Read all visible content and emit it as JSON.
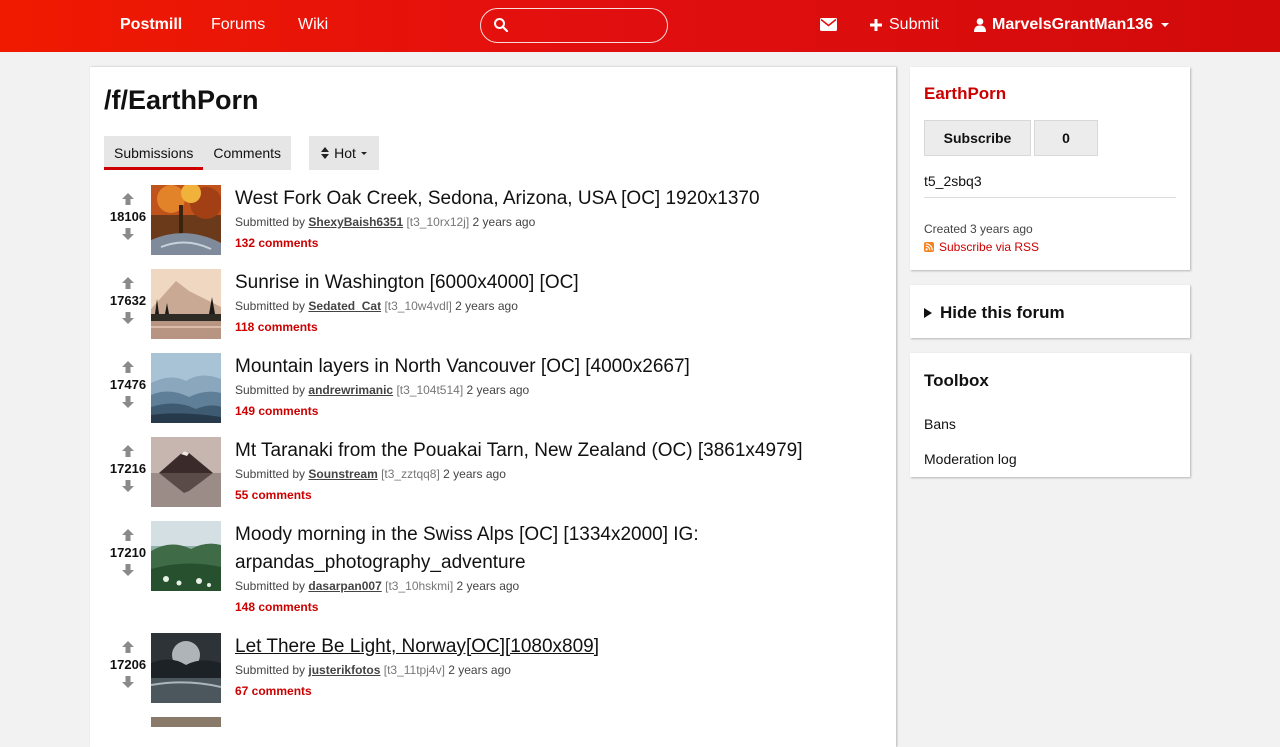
{
  "nav": {
    "brand": "Postmill",
    "forums": "Forums",
    "wiki": "Wiki",
    "search_placeholder": "",
    "submit": "Submit",
    "user": "MarvelsGrantMan136"
  },
  "forum": {
    "title": "/f/EarthPorn",
    "tabs": [
      "Submissions",
      "Comments"
    ],
    "sort": "Hot"
  },
  "submissions": [
    {
      "score": "18106",
      "title": "West Fork Oak Creek, Sedona, Arizona, USA [OC] 1920x1370",
      "submitted_by": "Submitted by",
      "author": "ShexyBaish6351",
      "id": "[t3_10rx12j]",
      "age": "2 years ago",
      "comments": "132 comments"
    },
    {
      "score": "17632",
      "title": "Sunrise in Washington [6000x4000] [OC]",
      "submitted_by": "Submitted by",
      "author": "Sedated_Cat",
      "id": "[t3_10w4vdl]",
      "age": "2 years ago",
      "comments": "118 comments"
    },
    {
      "score": "17476",
      "title": "Mountain layers in North Vancouver [OC] [4000x2667]",
      "submitted_by": "Submitted by",
      "author": "andrewrimanic",
      "id": "[t3_104t514]",
      "age": "2 years ago",
      "comments": "149 comments"
    },
    {
      "score": "17216",
      "title": "Mt Taranaki from the Pouakai Tarn, New Zealand (OC) [3861x4979]",
      "submitted_by": "Submitted by",
      "author": "Sounstream",
      "id": "[t3_zztqq8]",
      "age": "2 years ago",
      "comments": "55 comments"
    },
    {
      "score": "17210",
      "title": "Moody morning in the Swiss Alps [OC] [1334x2000] IG: arpandas_photography_adventure",
      "submitted_by": "Submitted by",
      "author": "dasarpan007",
      "id": "[t3_10hskmi]",
      "age": "2 years ago",
      "comments": "148 comments"
    },
    {
      "score": "17206",
      "title": "Let There Be Light, Norway[OC][1080x809]",
      "submitted_by": "Submitted by",
      "author": "justerikfotos",
      "id": "[t3_11tpj4v]",
      "age": "2 years ago",
      "comments": "67 comments"
    }
  ],
  "sidebar": {
    "forum_name": "EarthPorn",
    "subscribe": "Subscribe",
    "subscriber_count": "0",
    "forum_id": "t5_2sbq3",
    "created": "Created 3 years ago",
    "rss": "Subscribe via RSS",
    "hide_forum": "Hide this forum",
    "toolbox_title": "Toolbox",
    "toolbox_links": [
      "Bans",
      "Moderation log"
    ]
  },
  "colors": {
    "accent": "#cc0000",
    "header": "#e8100a"
  }
}
